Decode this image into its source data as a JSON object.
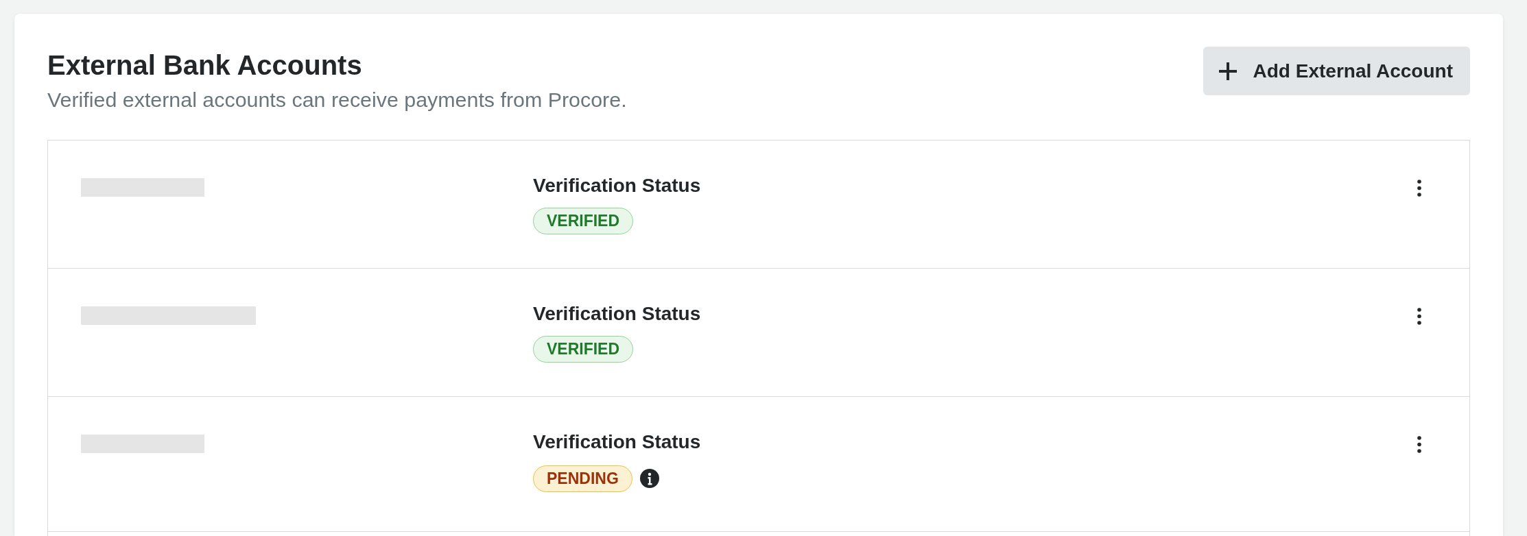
{
  "section": {
    "title": "External Bank Accounts",
    "subtitle": "Verified external accounts can receive payments from Procore."
  },
  "add_button": {
    "label": "Add External Account"
  },
  "accounts": [
    {
      "status_label": "Verification Status",
      "status": {
        "kind": "verified",
        "label": "VERIFIED"
      },
      "info": false
    },
    {
      "status_label": "Verification Status",
      "status": {
        "kind": "verified",
        "label": "VERIFIED"
      },
      "info": false
    },
    {
      "status_label": "Verification Status",
      "status": {
        "kind": "pending",
        "label": "PENDING"
      },
      "info": true
    }
  ]
}
